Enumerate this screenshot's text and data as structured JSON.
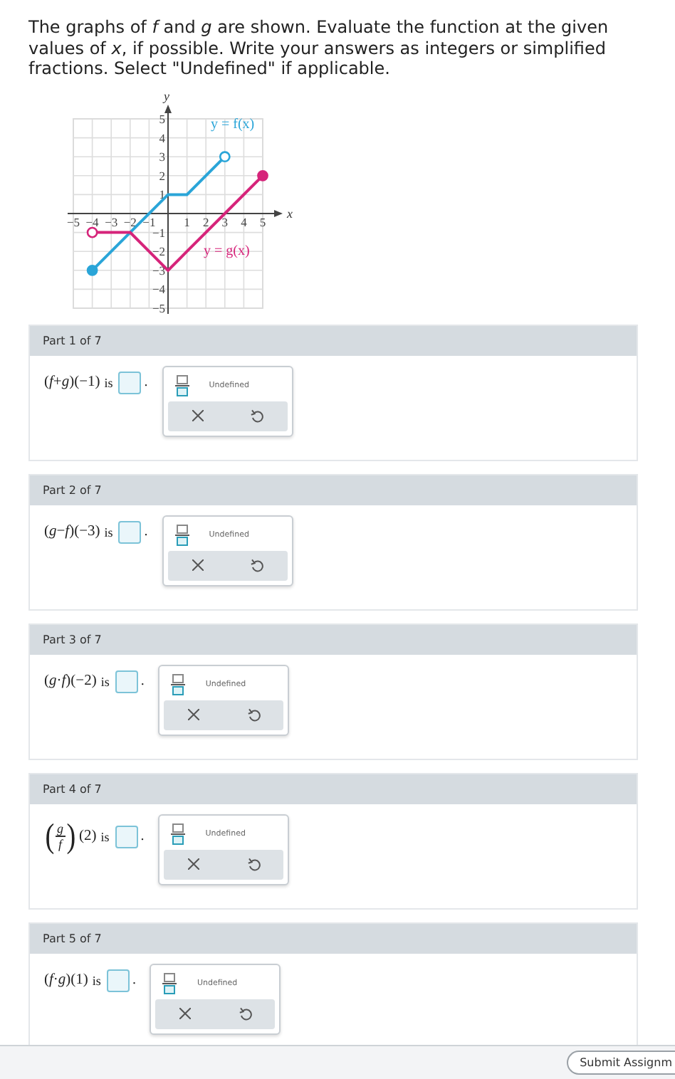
{
  "instructions": "The graphs of *f* and *g* are shown. Evaluate the function at the given values of *x*, if possible. Write your answers as integers or simplified fractions. Select \"Undefined\" if applicable.",
  "graph": {
    "chart_data": {
      "type": "line",
      "xlabel": "x",
      "ylabel": "y",
      "x": [
        -4,
        -2,
        0,
        1,
        3,
        5
      ],
      "xlim": [
        -5,
        5
      ],
      "ylim": [
        -5,
        5
      ],
      "grid": true,
      "xticks": [
        -5,
        -4,
        -3,
        -2,
        -1,
        1,
        2,
        3,
        4,
        5
      ],
      "yticks": [
        -5,
        -4,
        -3,
        -2,
        -1,
        1,
        2,
        3,
        4,
        5
      ],
      "series": [
        {
          "name": "y = f(x)",
          "color": "#2aa5d8",
          "values": [
            -3,
            -1,
            1,
            1,
            3,
            null
          ]
        },
        {
          "name": "y = g(x)",
          "color": "#d6247a",
          "values": [
            -1,
            -1,
            -3,
            -2,
            0,
            2
          ]
        }
      ]
    },
    "endpoints": [
      {
        "start_filled": true,
        "end_filled": false
      },
      {
        "start_filled": false,
        "end_filled": true
      }
    ]
  },
  "parts": [
    {
      "title": "Part 1 of 7",
      "expression": [
        {
          "kind": "text",
          "text": "(*f*+*g*)(−1)"
        }
      ],
      "connector": "is",
      "punct": ".",
      "undefined_label": "Undefined"
    },
    {
      "title": "Part 2 of 7",
      "expression": [
        {
          "kind": "text",
          "text": "(*g*−*f*)(−3)"
        }
      ],
      "connector": "is",
      "punct": ".",
      "undefined_label": "Undefined"
    },
    {
      "title": "Part 3 of 7",
      "expression": [
        {
          "kind": "text",
          "text": "(*g*·*f*)(−2)"
        }
      ],
      "connector": "is",
      "punct": ".",
      "undefined_label": "Undefined"
    },
    {
      "title": "Part 4 of 7",
      "expression": [
        {
          "kind": "frac",
          "open": "(",
          "num": "g",
          "den": "f",
          "close": ")"
        },
        {
          "kind": "text",
          "text": "(2)"
        }
      ],
      "connector": "is",
      "punct": ".",
      "undefined_label": "Undefined"
    },
    {
      "title": "Part 5 of 7",
      "expression": [
        {
          "kind": "text",
          "text": "(*f*·*g*)(1)"
        }
      ],
      "connector": "is",
      "punct": ".",
      "undefined_label": "Undefined"
    }
  ],
  "submit_button": "Submit Assignm"
}
